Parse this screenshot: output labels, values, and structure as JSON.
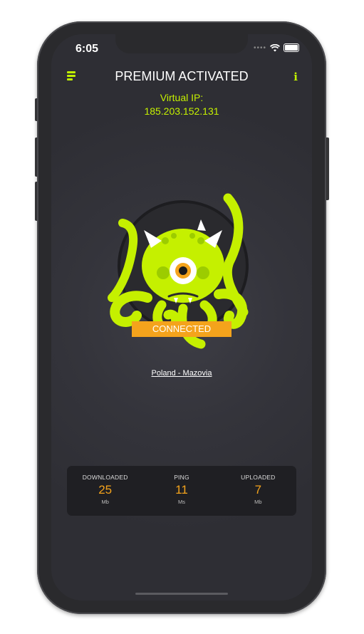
{
  "status_bar": {
    "time": "6:05"
  },
  "header": {
    "title": "PREMIUM ACTIVATED",
    "info_glyph": "i"
  },
  "virtual_ip": {
    "label": "Virtual IP:",
    "value": "185.203.152.131"
  },
  "connection": {
    "status": "CONNECTED",
    "location": "Poland - Mazovia"
  },
  "stats": [
    {
      "label": "DOWNLOADED",
      "value": "25",
      "unit": "Mb"
    },
    {
      "label": "PING",
      "value": "11",
      "unit": "Ms"
    },
    {
      "label": "UPLOADED",
      "value": "7",
      "unit": "Mb"
    }
  ],
  "colors": {
    "accent": "#c5f000",
    "orange": "#f4a31c",
    "background": "#33333a"
  },
  "icons": [
    "menu-icon",
    "info-icon",
    "wifi-icon",
    "battery-icon",
    "signal-dots-icon",
    "octopus-mascot"
  ]
}
